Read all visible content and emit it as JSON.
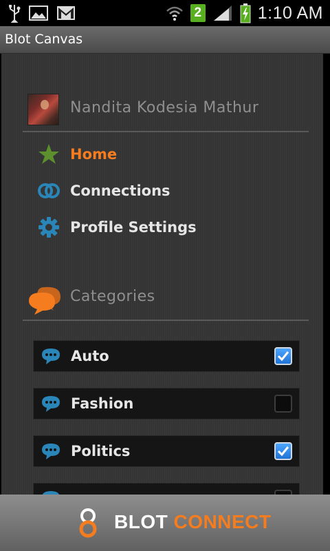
{
  "status_bar": {
    "notification_icons": [
      "usb-icon",
      "image-icon",
      "gmail-icon"
    ],
    "wifi_icon": "wifi-icon",
    "badge_count": "2",
    "signal_icon": "signal-icon",
    "battery_icon": "battery-charging-icon",
    "time": "1:10 AM"
  },
  "app": {
    "title": "Blot Canvas"
  },
  "profile": {
    "name": "Nandita Kodesia Mathur",
    "avatar_icon": "profile-photo"
  },
  "nav": [
    {
      "label": "Home",
      "icon": "star-icon",
      "active": true
    },
    {
      "label": "Connections",
      "icon": "connections-icon",
      "active": false
    },
    {
      "label": "Profile Settings",
      "icon": "gear-icon",
      "active": false
    }
  ],
  "categories": {
    "header": "Categories",
    "header_icon": "chat-bubbles-icon",
    "items": [
      {
        "label": "Auto",
        "checked": true
      },
      {
        "label": "Fashion",
        "checked": false
      },
      {
        "label": "Politics",
        "checked": true
      }
    ]
  },
  "footer": {
    "brand_blot": "BLOT",
    "brand_connect": "CONNECT"
  },
  "colors": {
    "accent": "#f57c1f",
    "icon_blue": "#2a86b8",
    "star_green": "#5d8f2e",
    "checkbox_blue": "#1f73d6"
  }
}
